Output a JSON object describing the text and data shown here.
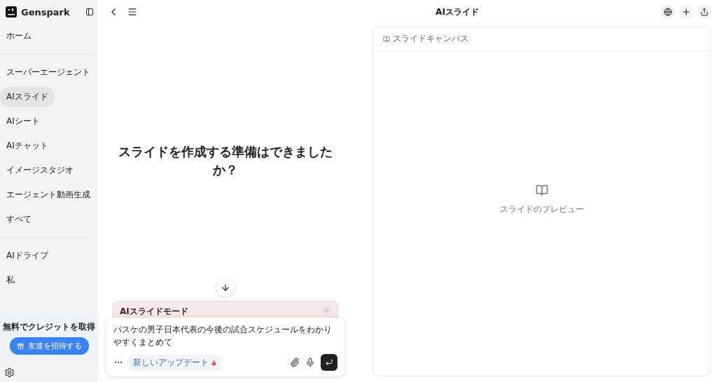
{
  "brand": {
    "name": "Genspark"
  },
  "sidebar": {
    "sections": [
      [
        {
          "label": "ホーム",
          "selected": false
        }
      ],
      [
        {
          "label": "スーパーエージェント",
          "selected": false
        },
        {
          "label": "AIスライド",
          "selected": true
        },
        {
          "label": "AIシート",
          "selected": false
        },
        {
          "label": "AIチャット",
          "selected": false
        },
        {
          "label": "イメージスタジオ",
          "selected": false
        },
        {
          "label": "エージェント動画生成",
          "selected": false
        },
        {
          "label": "すべて",
          "selected": false
        }
      ],
      [
        {
          "label": "AIドライブ",
          "selected": false
        },
        {
          "label": "私",
          "selected": false
        }
      ]
    ],
    "promo": {
      "title": "無料でクレジットを取得",
      "button": "友達を招待する"
    }
  },
  "header": {
    "title": "AIスライド"
  },
  "main": {
    "heading": "スライドを作成する準備はできましたか？"
  },
  "composer": {
    "mode": "AIスライドモード",
    "value": "バスケの男子日本代表の今後の試合スケジュールをわかりやすくまとめて",
    "update_badge": "新しいアップデート"
  },
  "canvas": {
    "title": "スライドキャンバス",
    "preview": "スライドのプレビュー"
  }
}
